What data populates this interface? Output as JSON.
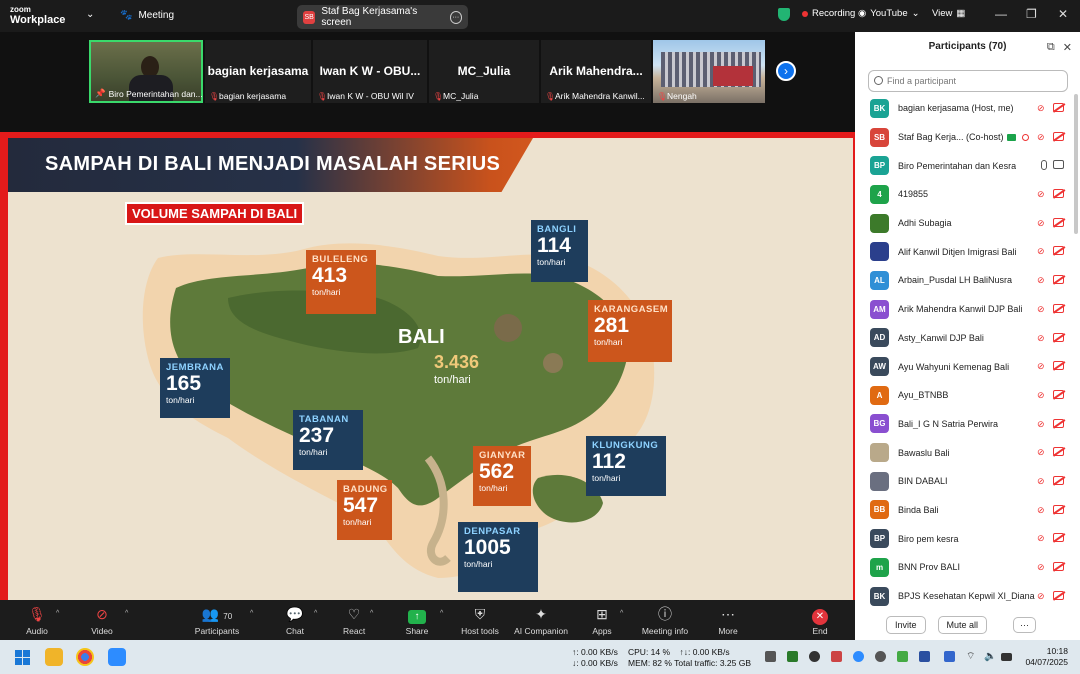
{
  "titlebar": {
    "logo_line1": "zoom",
    "logo_line2": "Workplace",
    "meeting_label": "Meeting",
    "tab_badge": "SB",
    "tab_title": "Staf Bag Kerjasama's screen",
    "recording_label": "Recording",
    "youtube_label": "YouTube",
    "view_label": "View"
  },
  "gallery": {
    "tiles": [
      {
        "name": "",
        "label": "Biro Pemerintahan dan..."
      },
      {
        "name": "bagian kerjasama",
        "label": "bagian kerjasama"
      },
      {
        "name": "Iwan K W - OBU...",
        "label": "Iwan K W - OBU Wil IV"
      },
      {
        "name": "MC_Julia",
        "label": "MC_Julia"
      },
      {
        "name": "Arik Mahendra...",
        "label": "Arik Mahendra Kanwil..."
      },
      {
        "name": "",
        "label": "Nengah"
      }
    ]
  },
  "slide": {
    "title": "SAMPAH DI BALI MENJADI MASALAH SERIUS",
    "subtitle": "VOLUME SAMPAH DI BALI",
    "center": {
      "name": "BALI",
      "value": "3.436",
      "unit": "ton/hari"
    },
    "regions": [
      {
        "name": "BULELENG",
        "value": "413",
        "unit": "ton/hari"
      },
      {
        "name": "BANGLI",
        "value": "114",
        "unit": "ton/hari"
      },
      {
        "name": "KARANGASEM",
        "value": "281",
        "unit": "ton/hari"
      },
      {
        "name": "JEMBRANA",
        "value": "165",
        "unit": "ton/hari"
      },
      {
        "name": "TABANAN",
        "value": "237",
        "unit": "ton/hari"
      },
      {
        "name": "GIANYAR",
        "value": "562",
        "unit": "ton/hari"
      },
      {
        "name": "KLUNGKUNG",
        "value": "112",
        "unit": "ton/hari"
      },
      {
        "name": "BADUNG",
        "value": "547",
        "unit": "ton/hari"
      },
      {
        "name": "DENPASAR",
        "value": "1005",
        "unit": "ton/hari"
      }
    ]
  },
  "participants": {
    "header": "Participants (70)",
    "search_placeholder": "Find a participant",
    "list": [
      {
        "initials": "BK",
        "color": "#1aa394",
        "name": "bagian kerjasama (Host, me)",
        "audio": "off"
      },
      {
        "initials": "SB",
        "color": "#d8453a",
        "name": "Staf Bag Kerja... (Co-host)",
        "audio": "off"
      },
      {
        "initials": "BP",
        "color": "#1aa394",
        "name": "Biro Pemerintahan dan Kesra",
        "audio": "on"
      },
      {
        "initials": "4",
        "color": "#1ea34a",
        "name": "419855",
        "audio": "off"
      },
      {
        "initials": "",
        "color": "#3c7a2a",
        "name": "Adhi Subagia",
        "audio": "off"
      },
      {
        "initials": "",
        "color": "#2b3f8c",
        "name": "Alif Kanwil Ditjen Imigrasi Bali",
        "audio": "off"
      },
      {
        "initials": "AL",
        "color": "#2f8fd6",
        "name": "Arbain_Pusdal LH BaliNusra",
        "audio": "off"
      },
      {
        "initials": "AM",
        "color": "#8a4fd0",
        "name": "Arik Mahendra Kanwil DJP Bali",
        "audio": "off"
      },
      {
        "initials": "AD",
        "color": "#3a4a5c",
        "name": "Asty_Kanwil DJP Bali",
        "audio": "off"
      },
      {
        "initials": "AW",
        "color": "#3a4a5c",
        "name": "Ayu Wahyuni Kemenag Bali",
        "audio": "off"
      },
      {
        "initials": "A",
        "color": "#e06a12",
        "name": "Ayu_BTNBB",
        "audio": "off"
      },
      {
        "initials": "BG",
        "color": "#8a4fd0",
        "name": "Bali_I G N Satria Perwira",
        "audio": "off"
      },
      {
        "initials": "",
        "color": "#b9a98a",
        "name": "Bawaslu Bali",
        "audio": "off"
      },
      {
        "initials": "",
        "color": "#6a6f80",
        "name": "BIN DABALI",
        "audio": "off"
      },
      {
        "initials": "BB",
        "color": "#e06a12",
        "name": "Binda Bali",
        "audio": "off"
      },
      {
        "initials": "BP",
        "color": "#3a4a5c",
        "name": "Biro pem kesra",
        "audio": "off"
      },
      {
        "initials": "m",
        "color": "#1ea34a",
        "name": "BNN Prov BALI",
        "audio": "off"
      },
      {
        "initials": "BK",
        "color": "#3a4a5c",
        "name": "BPJS Kesehatan Kepwil XI_Diana",
        "audio": "off"
      }
    ],
    "invite_label": "Invite",
    "mute_all_label": "Mute all",
    "more_label": "···"
  },
  "toolbar": {
    "audio": "Audio",
    "video": "Video",
    "participants": "Participants",
    "participants_count": "70",
    "chat": "Chat",
    "react": "React",
    "share": "Share",
    "host_tools": "Host tools",
    "ai_companion": "AI Companion",
    "apps": "Apps",
    "meeting_info": "Meeting info",
    "more": "More",
    "end": "End"
  },
  "taskbar": {
    "net_up": "↑: 0.00 KB/s",
    "net_down": "↓: 0.00 KB/s",
    "cpu": "CPU: 14 %",
    "mem": "MEM: 82 %",
    "io": "↑↓: 0.00 KB/s",
    "traffic": "Total traffic: 3.25 GB",
    "time": "10:18",
    "date": "04/07/2025"
  }
}
